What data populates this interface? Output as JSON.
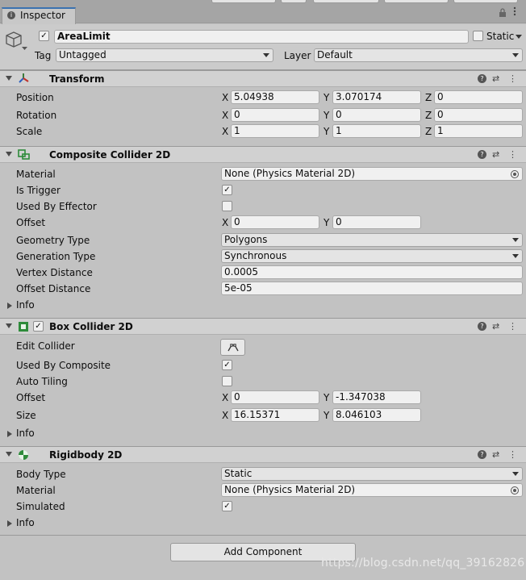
{
  "window": {
    "tab_label": "Inspector",
    "lock_icon": "lock-icon",
    "menu_icon": "kebab-menu-icon"
  },
  "gameobject": {
    "enabled": true,
    "name": "AreaLimit",
    "static_label": "Static",
    "static_checked": false,
    "tag_label": "Tag",
    "tag_value": "Untagged",
    "layer_label": "Layer",
    "layer_value": "Default"
  },
  "transform": {
    "title": "Transform",
    "position_label": "Position",
    "rotation_label": "Rotation",
    "scale_label": "Scale",
    "axis_x": "X",
    "axis_y": "Y",
    "axis_z": "Z",
    "position": {
      "x": "5.04938",
      "y": "3.070174",
      "z": "0"
    },
    "rotation": {
      "x": "0",
      "y": "0",
      "z": "0"
    },
    "scale": {
      "x": "1",
      "y": "1",
      "z": "1"
    }
  },
  "composite": {
    "title": "Composite Collider 2D",
    "material_label": "Material",
    "material_value": "None (Physics Material 2D)",
    "is_trigger_label": "Is Trigger",
    "is_trigger": true,
    "used_by_effector_label": "Used By Effector",
    "used_by_effector": false,
    "offset_label": "Offset",
    "offset": {
      "x": "0",
      "y": "0"
    },
    "geometry_type_label": "Geometry Type",
    "geometry_type": "Polygons",
    "generation_type_label": "Generation Type",
    "generation_type": "Synchronous",
    "vertex_distance_label": "Vertex Distance",
    "vertex_distance": "0.0005",
    "offset_distance_label": "Offset Distance",
    "offset_distance": "5e-05",
    "info_label": "Info"
  },
  "box": {
    "title": "Box Collider 2D",
    "enabled": true,
    "edit_collider_label": "Edit Collider",
    "used_by_composite_label": "Used By Composite",
    "used_by_composite": true,
    "auto_tiling_label": "Auto Tiling",
    "auto_tiling": false,
    "offset_label": "Offset",
    "offset": {
      "x": "0",
      "y": "-1.347038"
    },
    "size_label": "Size",
    "size": {
      "x": "16.15371",
      "y": "8.046103"
    },
    "info_label": "Info"
  },
  "rigidbody": {
    "title": "Rigidbody 2D",
    "body_type_label": "Body Type",
    "body_type": "Static",
    "material_label": "Material",
    "material_value": "None (Physics Material 2D)",
    "simulated_label": "Simulated",
    "simulated": true,
    "info_label": "Info"
  },
  "add_component_label": "Add Component",
  "watermark": "https://blog.csdn.net/qq_39162826",
  "colors": {
    "accent": "#3a72b0",
    "panel_bg": "#c2c2c2",
    "header_bg": "#d1d1d1",
    "field_bg": "#f0f0f0"
  }
}
